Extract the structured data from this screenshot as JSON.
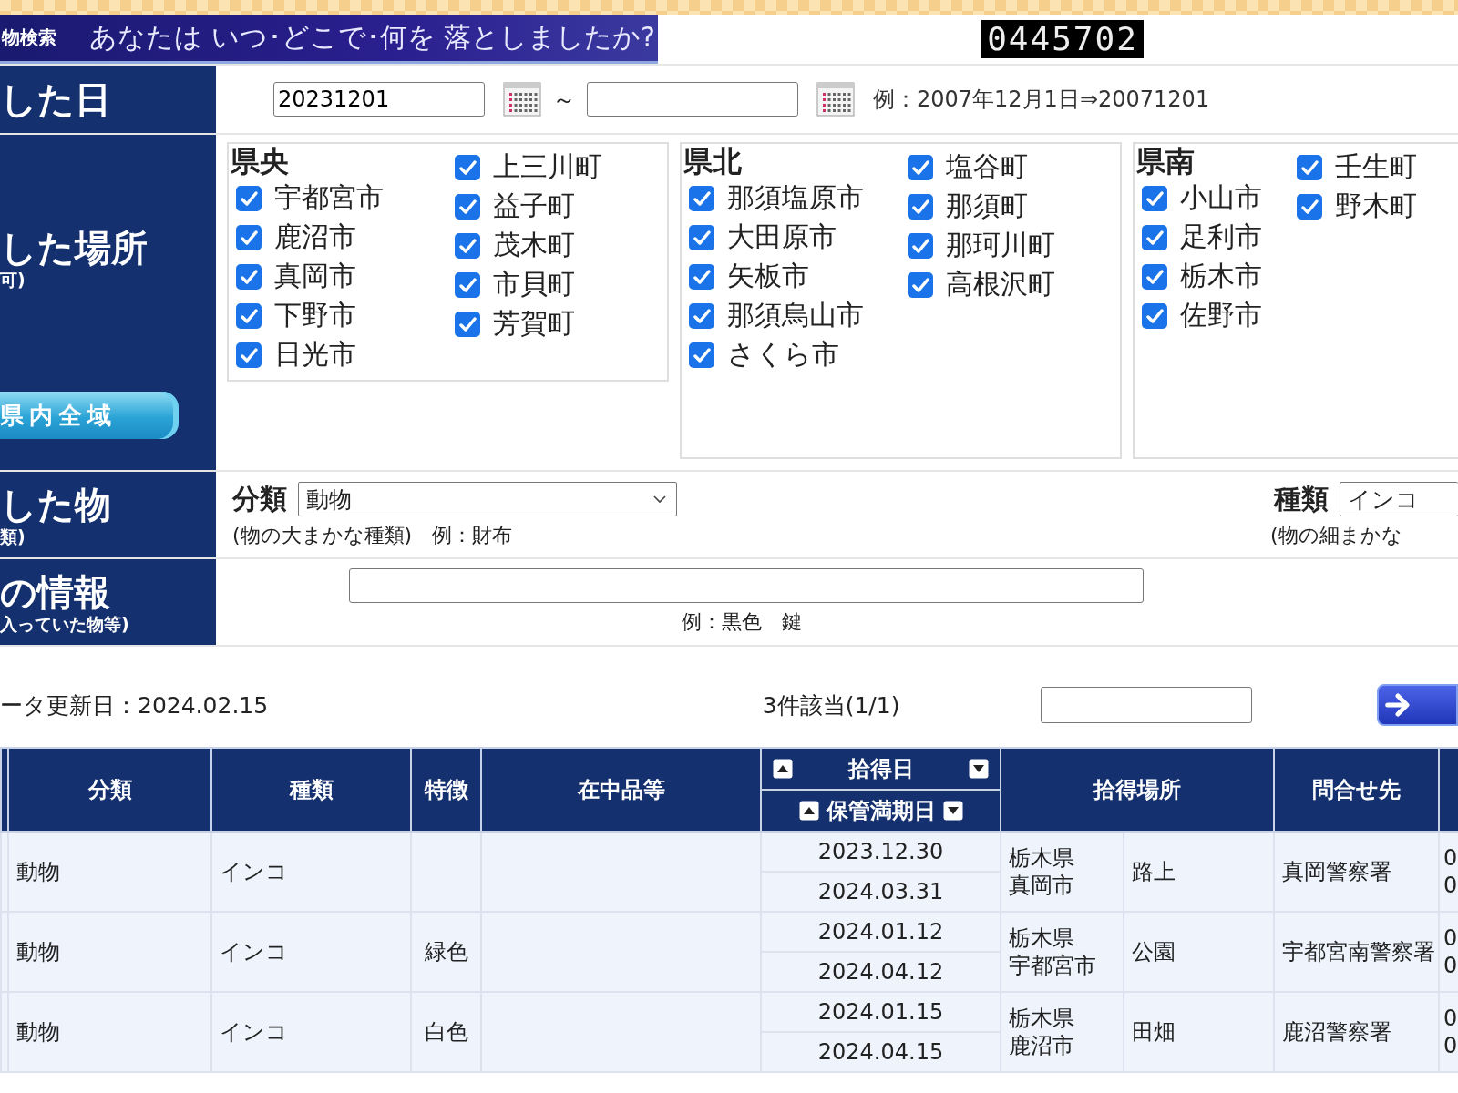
{
  "header": {
    "section": "物検索",
    "question": "あなたは いつ･どこで･何を 落としましたか?",
    "counter": "0445702"
  },
  "date_row": {
    "label": "した日",
    "from": "20231201",
    "separator": "～",
    "example": "例：2007年12月1日⇒20071201"
  },
  "place_row": {
    "label": "した場所",
    "note": "可)",
    "all_button": "県内全域",
    "regions": [
      {
        "title": "県央",
        "columns": [
          [
            {
              "name": "宇都宮市",
              "checked": true
            },
            {
              "name": "鹿沼市",
              "checked": true
            },
            {
              "name": "真岡市",
              "checked": true
            },
            {
              "name": "下野市",
              "checked": true
            },
            {
              "name": "日光市",
              "checked": true
            }
          ],
          [
            {
              "name": "上三川町",
              "checked": true
            },
            {
              "name": "益子町",
              "checked": true
            },
            {
              "name": "茂木町",
              "checked": true
            },
            {
              "name": "市貝町",
              "checked": true
            },
            {
              "name": "芳賀町",
              "checked": true
            }
          ]
        ]
      },
      {
        "title": "県北",
        "columns": [
          [
            {
              "name": "那須塩原市",
              "checked": true
            },
            {
              "name": "大田原市",
              "checked": true
            },
            {
              "name": "矢板市",
              "checked": true
            },
            {
              "name": "那須烏山市",
              "checked": true
            },
            {
              "name": "さくら市",
              "checked": true
            }
          ],
          [
            {
              "name": "塩谷町",
              "checked": true
            },
            {
              "name": "那須町",
              "checked": true
            },
            {
              "name": "那珂川町",
              "checked": true
            },
            {
              "name": "高根沢町",
              "checked": true
            }
          ]
        ]
      },
      {
        "title": "県南",
        "columns": [
          [
            {
              "name": "小山市",
              "checked": true
            },
            {
              "name": "足利市",
              "checked": true
            },
            {
              "name": "栃木市",
              "checked": true
            },
            {
              "name": "佐野市",
              "checked": true
            }
          ],
          [
            {
              "name": "壬生町",
              "checked": true
            },
            {
              "name": "野木町",
              "checked": true
            }
          ]
        ]
      }
    ]
  },
  "item_row": {
    "label": "した物",
    "note": "類)",
    "category_label": "分類",
    "category_value": "動物",
    "category_hint": "(物の大まかな種類)　例：財布",
    "type_label": "種類",
    "type_value": "インコ",
    "type_hint": "(物の細まかな"
  },
  "other_row": {
    "label": "の情報",
    "note": "入っていた物等)",
    "hint": "例：黒色　鍵"
  },
  "results": {
    "updated": "ータ更新日：2024.02.15",
    "count": "3件該当(1/1)"
  },
  "table": {
    "columns": [
      "分類",
      "種類",
      "特徴",
      "在中品等",
      "拾得日",
      "保管満期日",
      "拾得場所",
      "問合せ先"
    ],
    "rows": [
      {
        "category": "動物",
        "type": "インコ",
        "feature": "",
        "found": "2023.12.30",
        "expiry": "2024.03.31",
        "prefecture": "栃木県",
        "city": "真岡市",
        "place": "路上",
        "contact": "真岡警察署",
        "column_10": [
          "0",
          "0"
        ]
      },
      {
        "category": "動物",
        "type": "インコ",
        "feature": "緑色",
        "found": "2024.01.12",
        "expiry": "2024.04.12",
        "prefecture": "栃木県",
        "city": "宇都宮市",
        "place": "公園",
        "contact": "宇都宮南警察署",
        "column_10": [
          "0",
          "0"
        ]
      },
      {
        "category": "動物",
        "type": "インコ",
        "feature": "白色",
        "found": "2024.01.15",
        "expiry": "2024.04.15",
        "prefecture": "栃木県",
        "city": "鹿沼市",
        "place": "田畑",
        "contact": "鹿沼警察署",
        "column_10": [
          "0",
          "0"
        ]
      }
    ]
  }
}
